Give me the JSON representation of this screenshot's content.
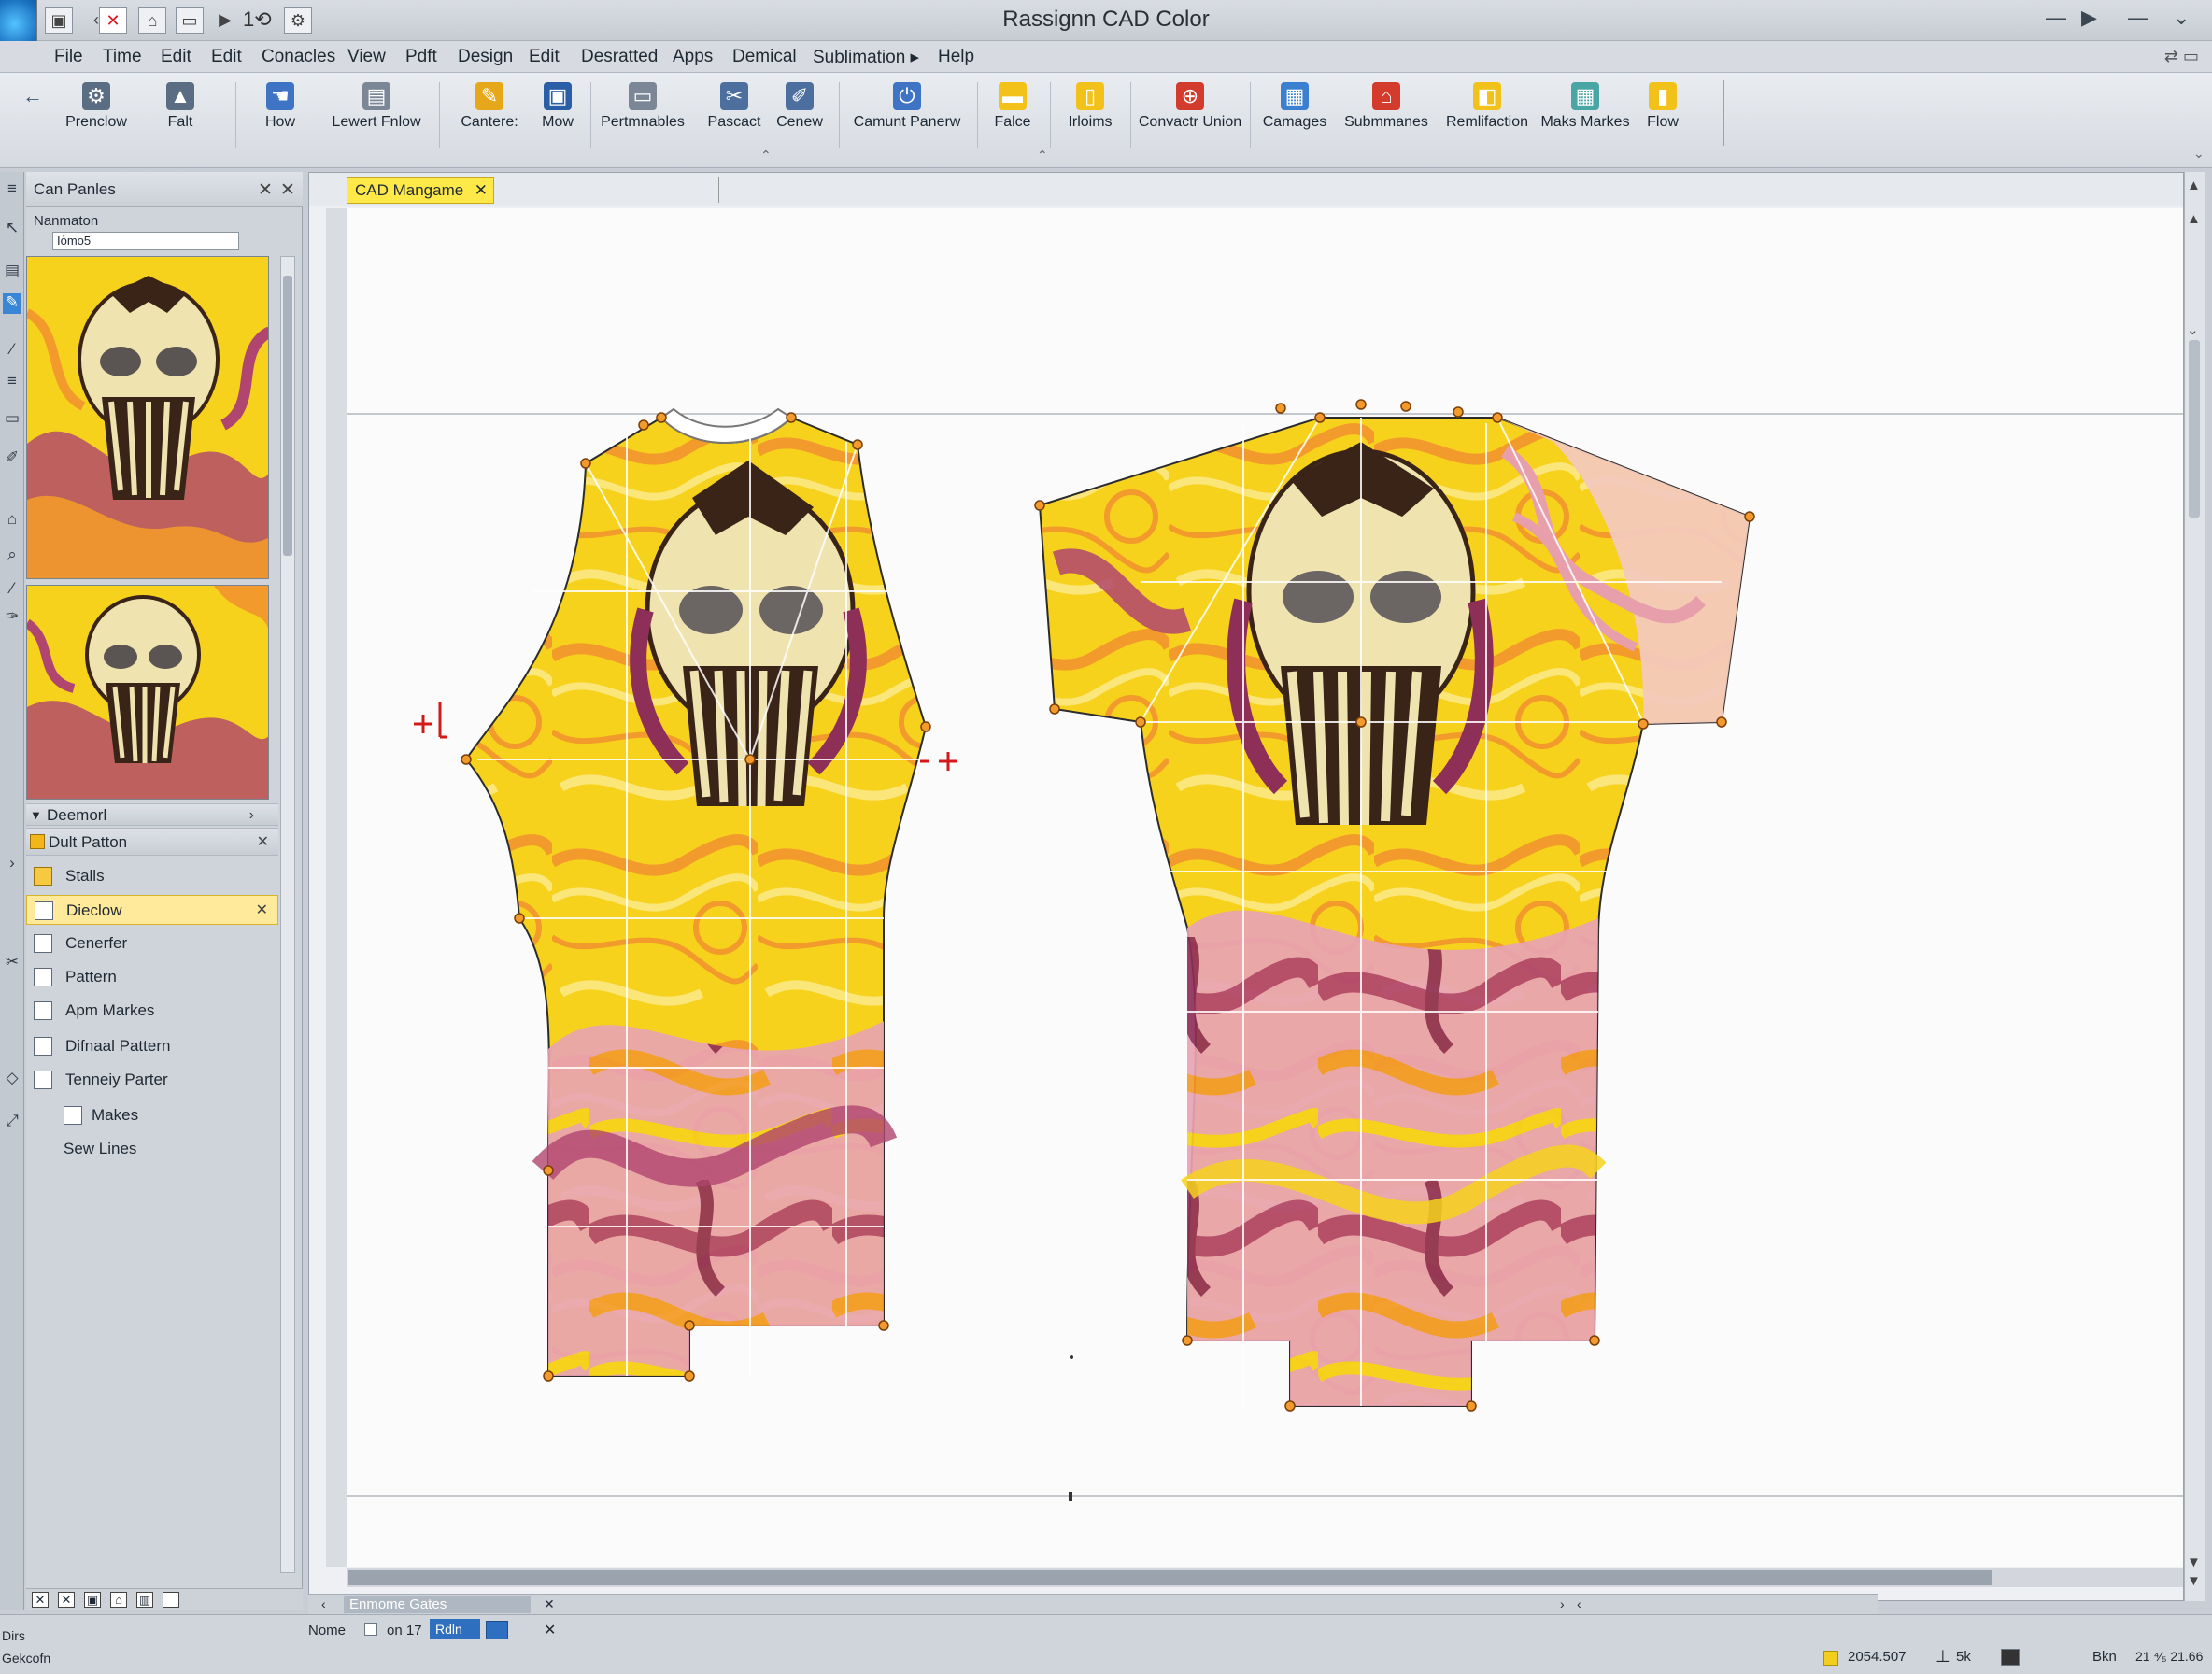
{
  "window": {
    "title": "Rassignn CAD Color",
    "quick_access_counter": "1⟲"
  },
  "menu": [
    "File",
    "Time",
    "Edit",
    "Edit",
    "Conacles",
    "View",
    "Pdft",
    "Design",
    "Edit",
    "Desratted",
    "Apps",
    "Demical",
    "Sublimation ▸",
    "Help"
  ],
  "ribbon": [
    {
      "label": "Prenclow",
      "icon": "gear-icon",
      "color": "#5b6d83"
    },
    {
      "label": "Falt",
      "icon": "shirt-icon",
      "color": "#5b6d83"
    },
    {
      "label": "How",
      "icon": "hand-icon",
      "color": "#3f74c4"
    },
    {
      "label": "Lewert Fnlow",
      "icon": "document-icon",
      "color": "#7b8796"
    },
    {
      "label": "Cantere:",
      "icon": "marker-icon",
      "color": "#e6a71a"
    },
    {
      "label": "Mow",
      "icon": "floppy-icon",
      "color": "#2a5fa8"
    },
    {
      "label": "Pertmnables",
      "icon": "panel-icon",
      "color": "#7b8796"
    },
    {
      "label": "Pascact",
      "icon": "scissors-icon",
      "color": "#4d6f9f"
    },
    {
      "label": "Cenew",
      "icon": "pencil-icon",
      "color": "#4d6f9f"
    },
    {
      "label": "Camunt Panerw",
      "icon": "power-icon",
      "color": "#3f74c4"
    },
    {
      "label": "Falce",
      "icon": "folder-icon",
      "color": "#f2c21a"
    },
    {
      "label": "Irloims",
      "icon": "file-icon",
      "color": "#f2c21a"
    },
    {
      "label": "Convactr Union",
      "icon": "union-icon",
      "color": "#d33b2c"
    },
    {
      "label": "Camages",
      "icon": "layers-icon",
      "color": "#3a7fd0"
    },
    {
      "label": "Submmanes",
      "icon": "pin-icon",
      "color": "#d33b2c"
    },
    {
      "label": "Remlifaction",
      "icon": "cube-icon",
      "color": "#f2c21a"
    },
    {
      "label": "Maks Markes",
      "icon": "grid-icon",
      "color": "#4aa5a5"
    },
    {
      "label": "Flow",
      "icon": "flow-icon",
      "color": "#f2c21a"
    }
  ],
  "left_panel": {
    "title": "Can Panles",
    "nav_label": "Nanmaton",
    "nav_value": "Iòmo5",
    "section": "Deemorl",
    "subheader": "Dult Patton",
    "items": [
      {
        "label": "Stalls",
        "selected": false
      },
      {
        "label": "Dieclow",
        "selected": true
      },
      {
        "label": "Cenerfer",
        "selected": false
      },
      {
        "label": "Pattern",
        "selected": false
      },
      {
        "label": "Apm Markes",
        "selected": false
      },
      {
        "label": "Difnaal Pattern",
        "selected": false
      },
      {
        "label": "Tenneiy Parter",
        "selected": false
      },
      {
        "label": "Makes",
        "selected": false
      },
      {
        "label": "Sew Lines",
        "selected": false
      }
    ]
  },
  "document": {
    "tab_label": "CAD Mangame"
  },
  "bottom": {
    "subtab": "Enmome Gates",
    "status_name": "Nome",
    "status_page": "on 17",
    "status_field": "Rdln",
    "coord_value": "2054.507",
    "scale": "5k",
    "zoom_label": "Bkn",
    "zoom_value": "21 ⁴⁄₅ 21.66",
    "left_label_1": "Dirs",
    "left_label_2": "Gekcofn"
  },
  "colors": {
    "accent_yellow": "#ffe948",
    "pattern_yellow": "#f6d21c",
    "pattern_magenta": "#b0456f",
    "pattern_orange": "#f29a2b"
  }
}
